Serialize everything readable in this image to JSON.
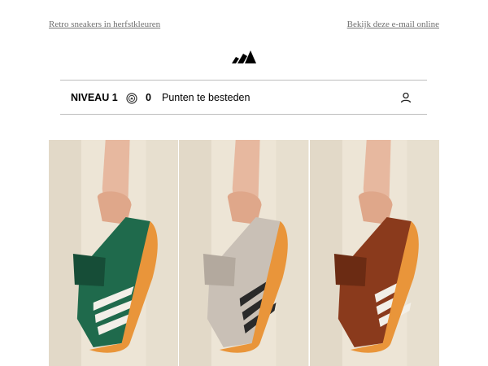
{
  "preheader": {
    "left_link": "Retro sneakers in herfstkleuren",
    "right_link": "Bekijk deze e-mail online"
  },
  "logo": {
    "icon": "adidas-performance-logo"
  },
  "loyalty": {
    "level": "NIVEAU 1",
    "coin_icon": "coin-icon",
    "points": "0",
    "points_label": "Punten te besteden",
    "account_icon": "user-icon"
  },
  "hero": {
    "panels": [
      {
        "name": "green",
        "shoe_color": "#1f6a4c",
        "shoe_dark": "#164d37"
      },
      {
        "name": "grey",
        "shoe_color": "#c9c0b6",
        "shoe_dark": "#a89e93"
      },
      {
        "name": "brown",
        "shoe_color": "#8a3a1c",
        "shoe_dark": "#6b2b13"
      }
    ],
    "background": "#ede5d6",
    "sole_color": "#e9953a"
  }
}
